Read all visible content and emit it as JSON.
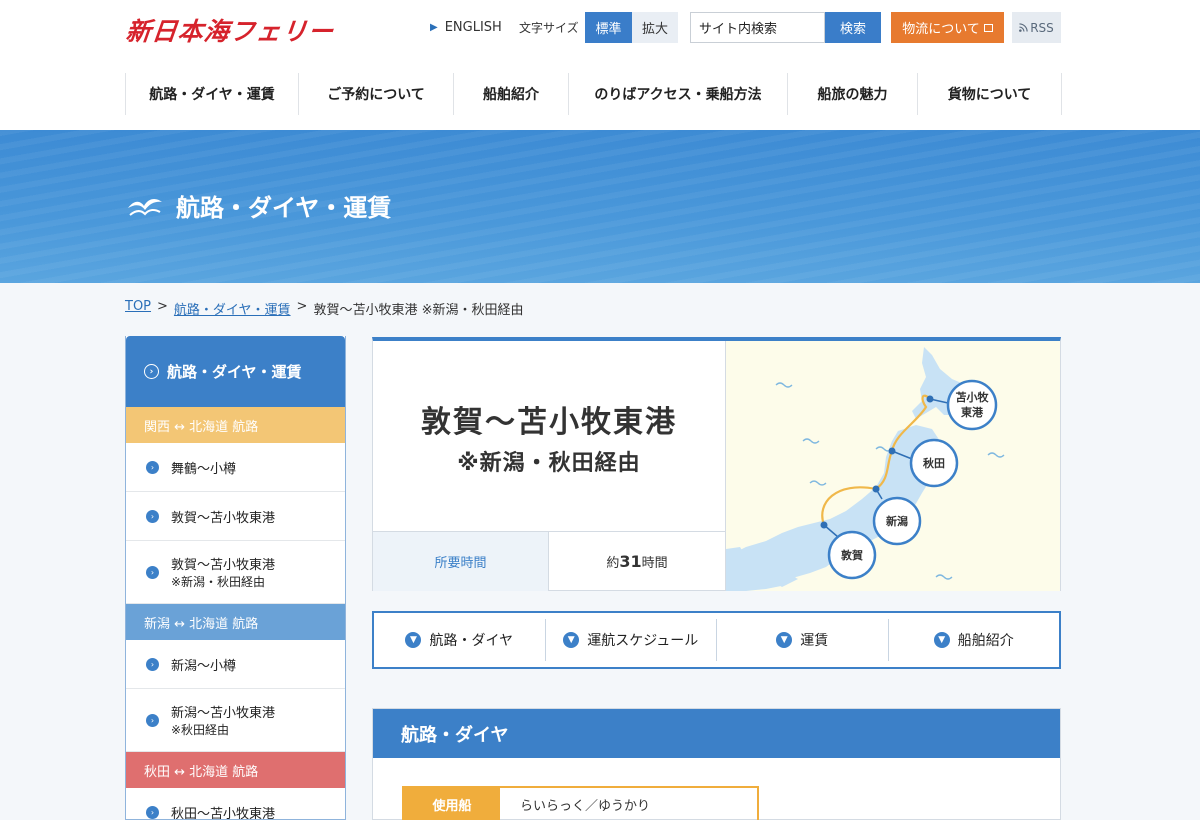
{
  "header": {
    "logo_text": "新日本海フェリー",
    "english_link": "ENGLISH",
    "font_size_label": "文字サイズ",
    "font_size_standard": "標準",
    "font_size_large": "拡大",
    "search_placeholder": "サイト内検索",
    "search_button": "検索",
    "logistics_button": "物流について",
    "rss_button": "RSS",
    "brand_color": "#d6232c",
    "accent_color": "#3c80c8"
  },
  "global_nav": [
    {
      "label": "航路・ダイヤ・運賃"
    },
    {
      "label": "ご予約について"
    },
    {
      "label": "船舶紹介"
    },
    {
      "label": "のりばアクセス・乗船方法"
    },
    {
      "label": "船旅の魅力"
    },
    {
      "label": "貨物について"
    }
  ],
  "hero": {
    "title": "航路・ダイヤ・運賃",
    "icon": "seagull-icon"
  },
  "breadcrumb": {
    "top": "TOP",
    "section": "航路・ダイヤ・運賃",
    "current": "敦賀〜苫小牧東港 ※新潟・秋田経由",
    "separator": ">"
  },
  "sidebar": {
    "title": "航路・ダイヤ・運賃",
    "categories": [
      {
        "label": "関西 ↔ 北海道 航路",
        "color": "#f3c675",
        "items": [
          {
            "line1": "舞鶴〜小樽",
            "line2": ""
          },
          {
            "line1": "敦賀〜苫小牧東港",
            "line2": ""
          },
          {
            "line1": "敦賀〜苫小牧東港",
            "line2": "※新潟・秋田経由"
          }
        ]
      },
      {
        "label": "新潟 ↔ 北海道 航路",
        "color": "#6aa2d7",
        "items": [
          {
            "line1": "新潟〜小樽",
            "line2": ""
          },
          {
            "line1": "新潟〜苫小牧東港",
            "line2": "※秋田経由"
          }
        ]
      },
      {
        "label": "秋田 ↔ 北海道 航路",
        "color": "#df6f6f",
        "items": [
          {
            "line1": "秋田〜苫小牧東港",
            "line2": ""
          }
        ]
      }
    ]
  },
  "route": {
    "title_line1": "敦賀〜苫小牧東港",
    "title_line2": "※新潟・秋田経由",
    "duration_label": "所要時間",
    "duration_prefix": "約",
    "duration_value": "31",
    "duration_suffix": "時間",
    "map_ports": [
      {
        "line1": "苫小牧",
        "line2": "東港"
      },
      {
        "line1": "秋田",
        "line2": ""
      },
      {
        "line1": "新潟",
        "line2": ""
      },
      {
        "line1": "敦賀",
        "line2": ""
      }
    ]
  },
  "tabs": [
    {
      "label": "航路・ダイヤ"
    },
    {
      "label": "運航スケジュール"
    },
    {
      "label": "運賃"
    },
    {
      "label": "船舶紹介"
    }
  ],
  "section": {
    "title": "航路・ダイヤ",
    "ship_label": "使用船",
    "ship_value": "らいらっく／ゆうかり"
  }
}
